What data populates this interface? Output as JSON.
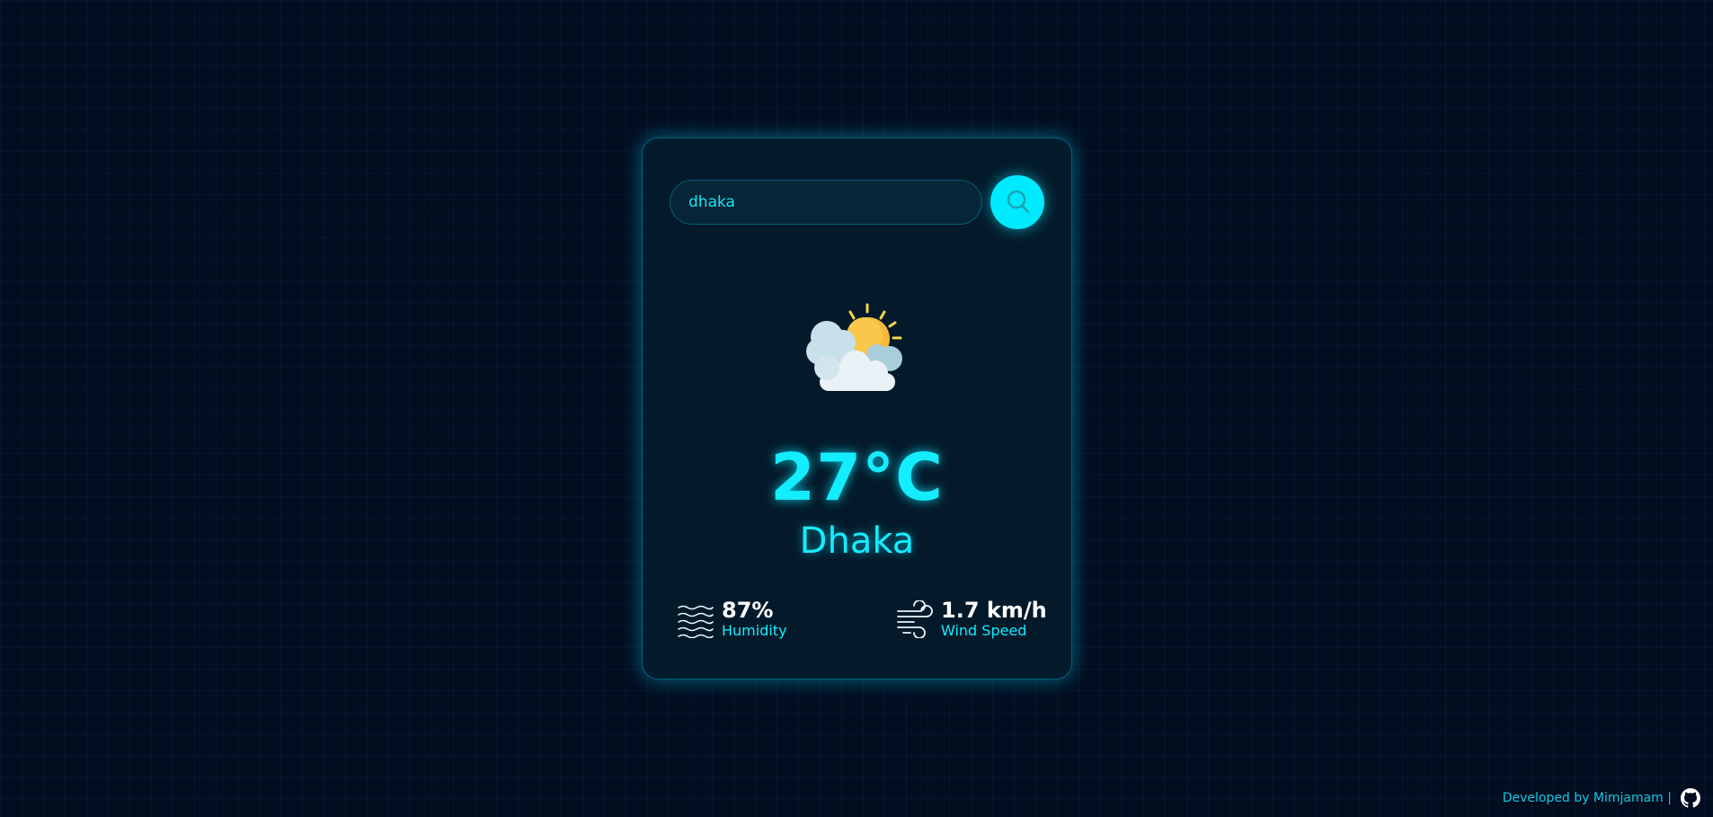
{
  "search": {
    "value": "dhaka",
    "button_icon": "search-icon"
  },
  "weather": {
    "icon": "partly-cloudy-icon",
    "temperature": "27°C",
    "city": "Dhaka"
  },
  "stats": {
    "humidity": {
      "icon": "humidity-waves-icon",
      "value": "87%",
      "label": "Humidity"
    },
    "wind": {
      "icon": "wind-icon",
      "value": "1.7 km/h",
      "label": "Wind Speed"
    }
  },
  "footer": {
    "text": "Developed by Mimjamam |",
    "icon": "github-icon"
  },
  "colors": {
    "accent": "#00eaff",
    "background": "#030d20",
    "card": "#041a2a"
  }
}
